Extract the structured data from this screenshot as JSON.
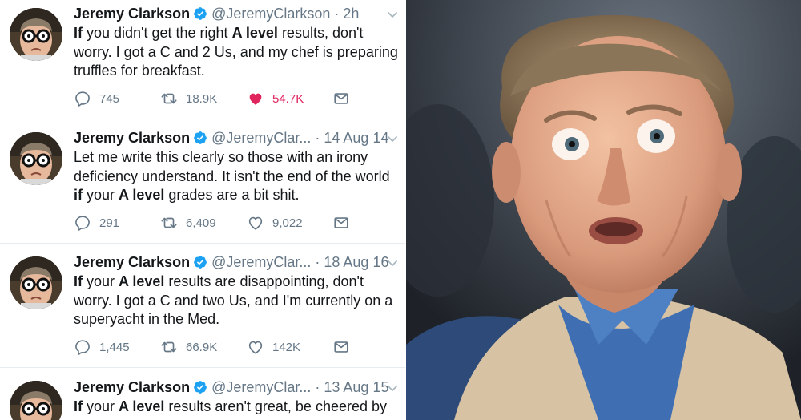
{
  "tweets": [
    {
      "name": "Jeremy Clarkson",
      "handle": "@JeremyClarkson",
      "date": "2h",
      "parts": [
        "If",
        " you didn't get the right ",
        "A level",
        " results, don't",
        "worry. I got a C and 2 Us, and my chef is preparing",
        "truffles for breakfast."
      ],
      "replies": "745",
      "retweets": "18.9K",
      "likes": "54.7K",
      "liked": true
    },
    {
      "name": "Jeremy Clarkson",
      "handle": "@JeremyClar...",
      "date": "14 Aug 14",
      "parts": [
        "Let me write this clearly so those with an irony",
        "deficiency understand. It isn't the end of the world",
        "if",
        " your ",
        "A level",
        " grades are a bit shit."
      ],
      "replies": "291",
      "retweets": "6,409",
      "likes": "9,022",
      "liked": false
    },
    {
      "name": "Jeremy Clarkson",
      "handle": "@JeremyClar...",
      "date": "18 Aug 16",
      "parts": [
        "If",
        " your ",
        "A level",
        " results are disappointing, don't",
        "worry. I got a C and two Us, and I'm currently on a",
        "superyacht in the Med."
      ],
      "replies": "1,445",
      "retweets": "66.9K",
      "likes": "142K",
      "liked": false
    },
    {
      "name": "Jeremy Clarkson",
      "handle": "@JeremyClar...",
      "date": "13 Aug 15",
      "parts": [
        "If",
        " your ",
        "A level",
        " results aren't great, be cheered by"
      ]
    }
  ],
  "icons": {
    "reply": "reply-icon",
    "retweet": "retweet-icon",
    "like": "heart-icon",
    "message": "direct-message-icon",
    "verified": "verified-badge-icon",
    "caret": "chevron-down-icon"
  },
  "colors": {
    "like_active": "#e0245e",
    "verified": "#1da1f2",
    "muted": "#657786",
    "text": "#14171a"
  }
}
